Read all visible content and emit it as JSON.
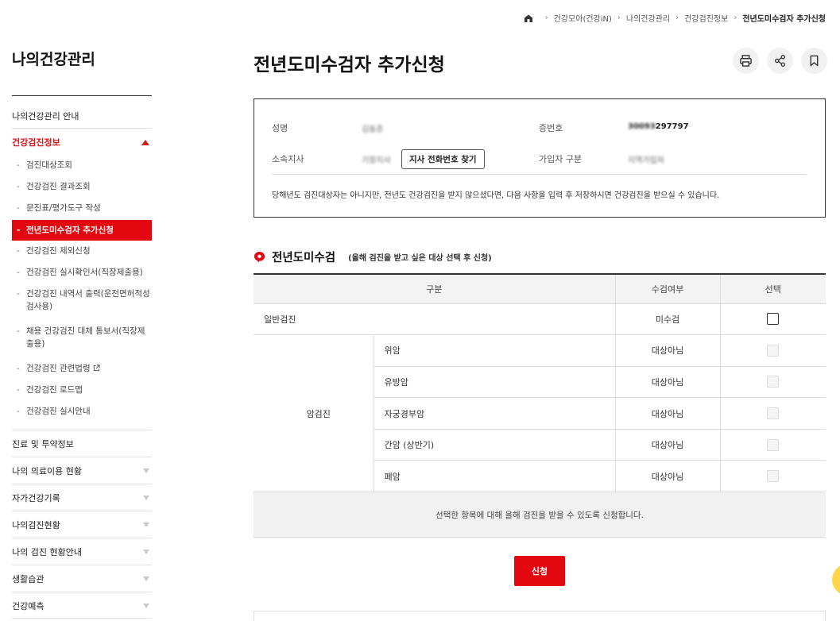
{
  "breadcrumb": {
    "items": [
      "건강모아(건강iN)",
      "나의건강관리",
      "건강검진정보",
      "전년도미수검자 추가신청"
    ]
  },
  "sidebar": {
    "title": "나의건강관리",
    "items": [
      {
        "label": "나의건강관리 안내"
      },
      {
        "label": "건강검진정보"
      },
      {
        "label": "진료 및 투약정보"
      },
      {
        "label": "나의 의료이용 현황"
      },
      {
        "label": "자가건강기록"
      },
      {
        "label": "나의검진현황"
      },
      {
        "label": "나의 검진 현황안내"
      },
      {
        "label": "생활습관"
      },
      {
        "label": "건강예측"
      }
    ],
    "subitems": [
      {
        "label": "검진대상조회"
      },
      {
        "label": "건강검진 결과조회"
      },
      {
        "label": "문진표/평가도구 작성"
      },
      {
        "label": "전년도미수검자 추가신청"
      },
      {
        "label": "건강검진 제외신청"
      },
      {
        "label": "건강검진 실시확인서(직장제출용)"
      },
      {
        "label": "건강검진 내역서 출력(운전면허적성검사용)"
      },
      {
        "label": "채용 건강검진 대체 통보서(직장제출용)"
      },
      {
        "label": "건강검진 관련법령"
      },
      {
        "label": "건강검진 로드맵"
      },
      {
        "label": "건강검진 실시안내"
      }
    ]
  },
  "page": {
    "title": "전년도미수검자 추가신청"
  },
  "info": {
    "name_label": "성명",
    "name_value": "김동준",
    "id_label": "증번호",
    "id_value_hidden": "30093",
    "id_value_visible": "297797",
    "branch_label": "소속지사",
    "branch_value": "기장지사",
    "find_button": "지사 전화번호 찾기",
    "type_label": "가입자 구분",
    "type_value": "지역가입자",
    "notice": "당해년도 검진대상자는 아니지만, 전년도 건강검진을 받지 않으셨다면, 다음 사항을 입력 후 저장하시면 건강검진을 받으실 수 있습니다."
  },
  "section": {
    "title": "전년도미수검",
    "subtitle": "(올해 검진을 받고 싶은 대상 선택 후 신청)"
  },
  "table": {
    "headers": [
      "구분",
      "수검여부",
      "선택"
    ],
    "general": {
      "label": "일반검진",
      "status": "미수검"
    },
    "cancer_group": "암검진",
    "cancer_rows": [
      {
        "label": "위암",
        "status": "대상아님"
      },
      {
        "label": "유방암",
        "status": "대상아님"
      },
      {
        "label": "자궁경부암",
        "status": "대상아님"
      },
      {
        "label": "간암 (상반기)",
        "status": "대상아님"
      },
      {
        "label": "폐암",
        "status": "대상아님"
      }
    ],
    "footer": "선택한 항목에 대해 올해 검진을 받을 수 있도록 신청합니다."
  },
  "apply_button": "신청",
  "colors": {
    "accent": "#e3080f"
  }
}
